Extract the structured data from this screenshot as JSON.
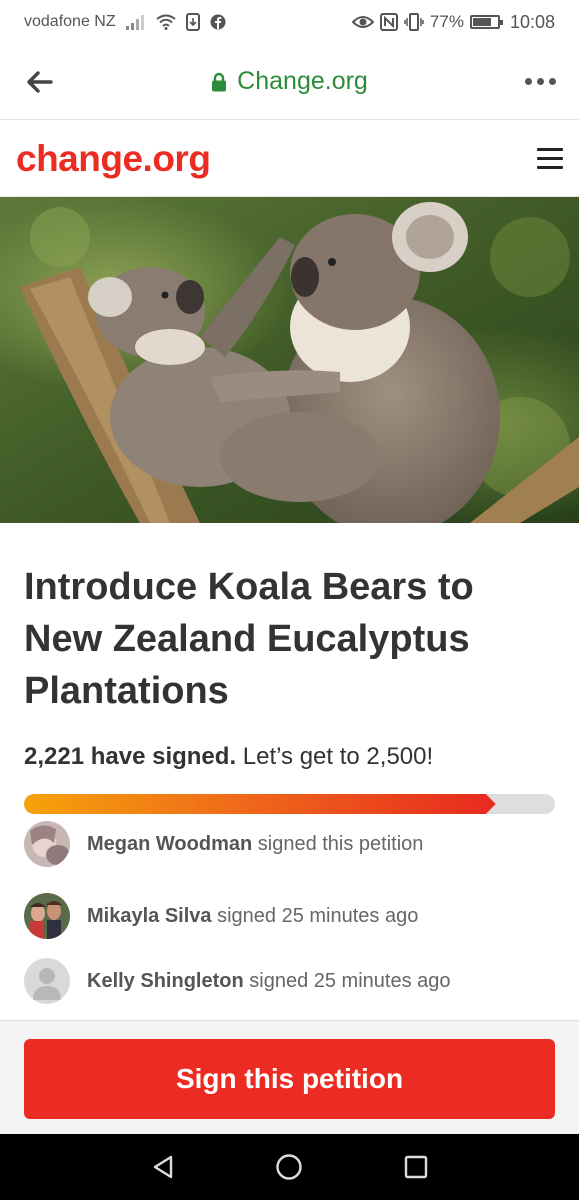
{
  "status_bar": {
    "carrier": "vodafone NZ",
    "battery": "77%",
    "time": "10:08",
    "icons": [
      "signal-icon",
      "wifi-icon",
      "sim-icon",
      "facebook-icon",
      "eye-icon",
      "nfc-icon",
      "vibrate-icon",
      "battery-icon"
    ]
  },
  "browser": {
    "url": "Change.org",
    "secure_icon": "lock-icon",
    "back_icon": "back-arrow-icon",
    "menu_icon": "more-dots-icon",
    "accent": "#2e8b3a"
  },
  "site": {
    "logo": "change.org",
    "menu_icon": "hamburger-icon",
    "brand_color": "#ec2c22"
  },
  "petition": {
    "title": "Introduce Koala Bears to New Zealand Eucalyptus Plantations",
    "signed_count": "2,221 have signed.",
    "goal_text": "Let’s get to 2,500!",
    "progress": 0.8884
  },
  "signers": [
    {
      "name": "Megan Woodman",
      "action": "signed this petition"
    },
    {
      "name": "Mikayla Silva",
      "action": "signed 25 minutes ago"
    },
    {
      "name": "Kelly Shingleton",
      "action": "signed 25 minutes ago"
    }
  ],
  "cta": {
    "label": "Sign this petition"
  },
  "nav_bar": {
    "icons": [
      "back-triangle-icon",
      "home-circle-icon",
      "recents-square-icon"
    ]
  }
}
